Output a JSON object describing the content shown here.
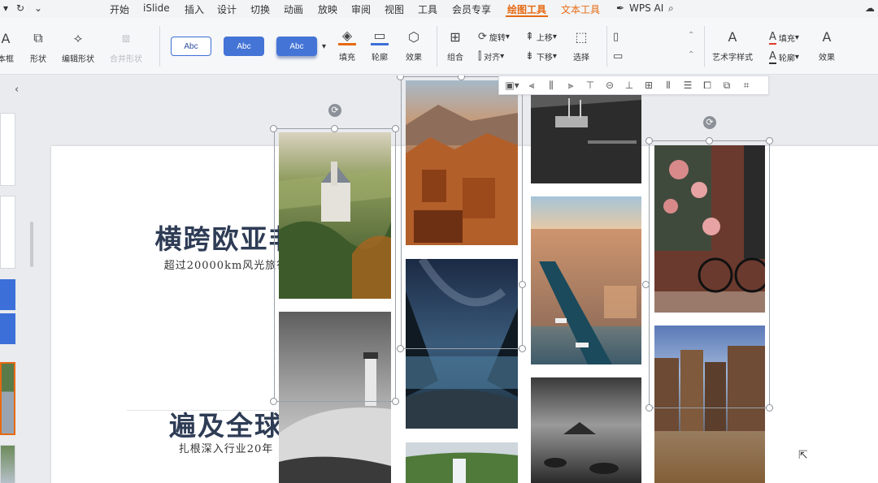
{
  "menubar": {
    "items": [
      "开始",
      "iSlide",
      "插入",
      "设计",
      "切换",
      "动画",
      "放映",
      "审阅",
      "视图",
      "工具",
      "会员专享",
      "绘图工具",
      "文本工具",
      "WPS AI"
    ],
    "active": "绘图工具"
  },
  "ribbon": {
    "textbox_label": "本框",
    "shape_label": "形状",
    "edit_shape_label": "编辑形状",
    "merge_shape_label": "合并形状",
    "styles": [
      "Abc",
      "Abc",
      "Abc"
    ],
    "fill_label": "填充",
    "outline_label": "轮廓",
    "effects_label": "效果",
    "group_label": "组合",
    "rotate_label": "旋转",
    "align_label": "对齐",
    "up_label": "上移",
    "down_label": "下移",
    "select_label": "选择",
    "art_text_label": "艺术字样式",
    "text_fill_label": "填充",
    "text_outline_label": "轮廓",
    "text_effects_label": "效果"
  },
  "colors": {
    "accent": "#e66a12",
    "style_blue": "#3c6fd8",
    "title": "#2e3c55"
  },
  "slide": {
    "title1": "横跨欧亚非",
    "subtitle1": "超过20000km风光旅行",
    "title2": "遍及全球",
    "subtitle2": "扎根深入行业20年"
  },
  "photos": [
    {
      "subject": "castle-in-forest"
    },
    {
      "subject": "lighthouse-on-dunes"
    },
    {
      "subject": "desert-kasbah"
    },
    {
      "subject": "starry-fjord"
    },
    {
      "subject": "waterfall"
    },
    {
      "subject": "boats-in-harbor"
    },
    {
      "subject": "city-canal-aerial"
    },
    {
      "subject": "rocky-shore"
    },
    {
      "subject": "bicycle-roses"
    },
    {
      "subject": "canal-houses-at-dusk"
    }
  ]
}
